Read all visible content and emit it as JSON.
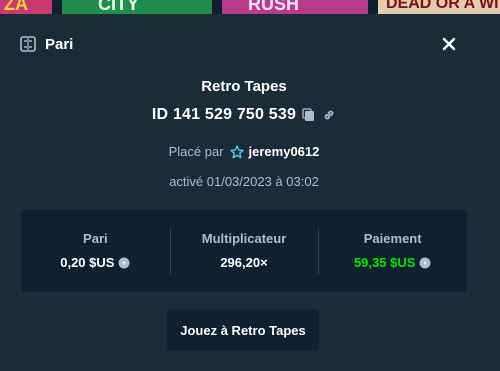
{
  "background": {
    "thumbs": [
      "ZA",
      "CITY",
      "RUSH",
      "DEAD OR A WI"
    ]
  },
  "modal": {
    "title": "Pari",
    "header_icon": "ticket-icon",
    "close_icon": "close-icon"
  },
  "bet": {
    "game": "Retro Tapes",
    "id_label": "ID 141 529 750 539",
    "placed_by_label": "Placé par",
    "user": "jeremy0612",
    "activated": "activé 01/03/2023 à 03:02"
  },
  "stats": {
    "bet_label": "Pari",
    "bet_value": "0,20 $US",
    "multiplier_label": "Multiplicateur",
    "multiplier_value": "296,20×",
    "payout_label": "Paiement",
    "payout_value": "59,35 $US"
  },
  "actions": {
    "play_label": "Jouez à Retro Tapes"
  },
  "colors": {
    "modal_bg": "#1a2c38",
    "panel_bg": "#0f212e",
    "payout_green": "#00e701",
    "muted_text": "#b1bad3"
  }
}
